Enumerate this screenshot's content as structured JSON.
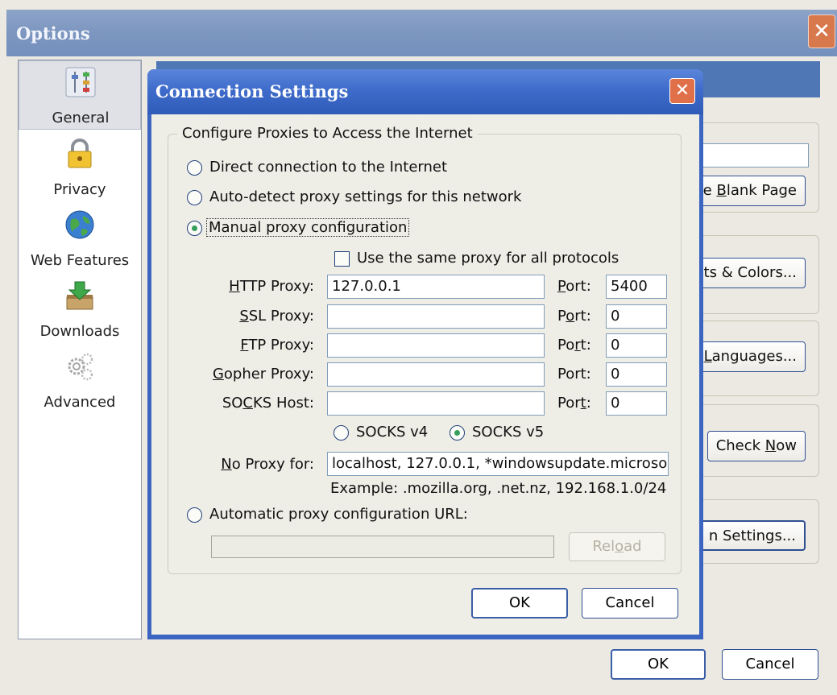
{
  "options_window": {
    "title": "Options",
    "close_glyph": "✕",
    "sidebar": [
      {
        "label": "General",
        "icon": "sliders-icon",
        "selected": true
      },
      {
        "label": "Privacy",
        "icon": "padlock-icon"
      },
      {
        "label": "Web Features",
        "icon": "globe-icon"
      },
      {
        "label": "Downloads",
        "icon": "download-box-icon"
      },
      {
        "label": "Advanced",
        "icon": "gears-icon"
      }
    ],
    "partial_buttons": {
      "blank_page": {
        "pre": "e ",
        "u": "B",
        "post": "lank Page"
      },
      "fonts_colors": "ts & Colors...",
      "languages": {
        "u": "L",
        "post": "anguages..."
      },
      "check_now": {
        "pre": "Check ",
        "u": "N",
        "post": "ow"
      },
      "connection_settings": "n Settings..."
    },
    "ok_label": "OK",
    "cancel_label": "Cancel"
  },
  "dialog": {
    "title": "Connection Settings",
    "close_glyph": "✕",
    "group_legend": "Configure Proxies to Access the Internet",
    "direct": "Direct connection to the Internet",
    "auto_detect": "Auto-detect proxy settings for this network",
    "manual": "Manual proxy configuration",
    "selected_mode": "manual",
    "same_proxy": "Use the same proxy for all protocols",
    "same_proxy_checked": false,
    "proxies": {
      "http": {
        "label_u": "H",
        "label_rest": "TTP Proxy:",
        "value": "127.0.0.1",
        "port_pre": "",
        "port_u": "P",
        "port_post": "ort:",
        "port": "5400"
      },
      "ssl": {
        "label_u": "S",
        "label_rest": "SL Proxy:",
        "value": "",
        "port_pre": "P",
        "port_u": "o",
        "port_post": "rt:",
        "port": "0"
      },
      "ftp": {
        "label_u": "F",
        "label_rest": "TP Proxy:",
        "value": "",
        "port_pre": "Po",
        "port_u": "r",
        "port_post": "t:",
        "port": "0"
      },
      "gopher": {
        "label_u": "G",
        "label_rest": "opher Proxy:",
        "value": "",
        "port_pre": "Port:",
        "port_u": "",
        "port_post": "",
        "port": "0"
      },
      "socks": {
        "label_pre": "SO",
        "label_u": "C",
        "label_rest": "KS Host:",
        "value": "",
        "port_pre": "Por",
        "port_u": "t",
        "port_post": ":",
        "port": "0"
      }
    },
    "socks_v4": "SOCKS v4",
    "socks_v5": "SOCKS v5",
    "socks_version": "v5",
    "no_proxy": {
      "label_u": "N",
      "label_rest": "o Proxy for:",
      "value": "localhost, 127.0.0.1, *windowsupdate.microso"
    },
    "example": "Example: .mozilla.org, .net.nz, 192.168.1.0/24",
    "auto_url": "Automatic proxy configuration URL:",
    "auto_url_value": "",
    "reload": {
      "pre": "Rel",
      "u": "o",
      "post": "ad"
    },
    "ok_label": "OK",
    "cancel_label": "Cancel"
  }
}
